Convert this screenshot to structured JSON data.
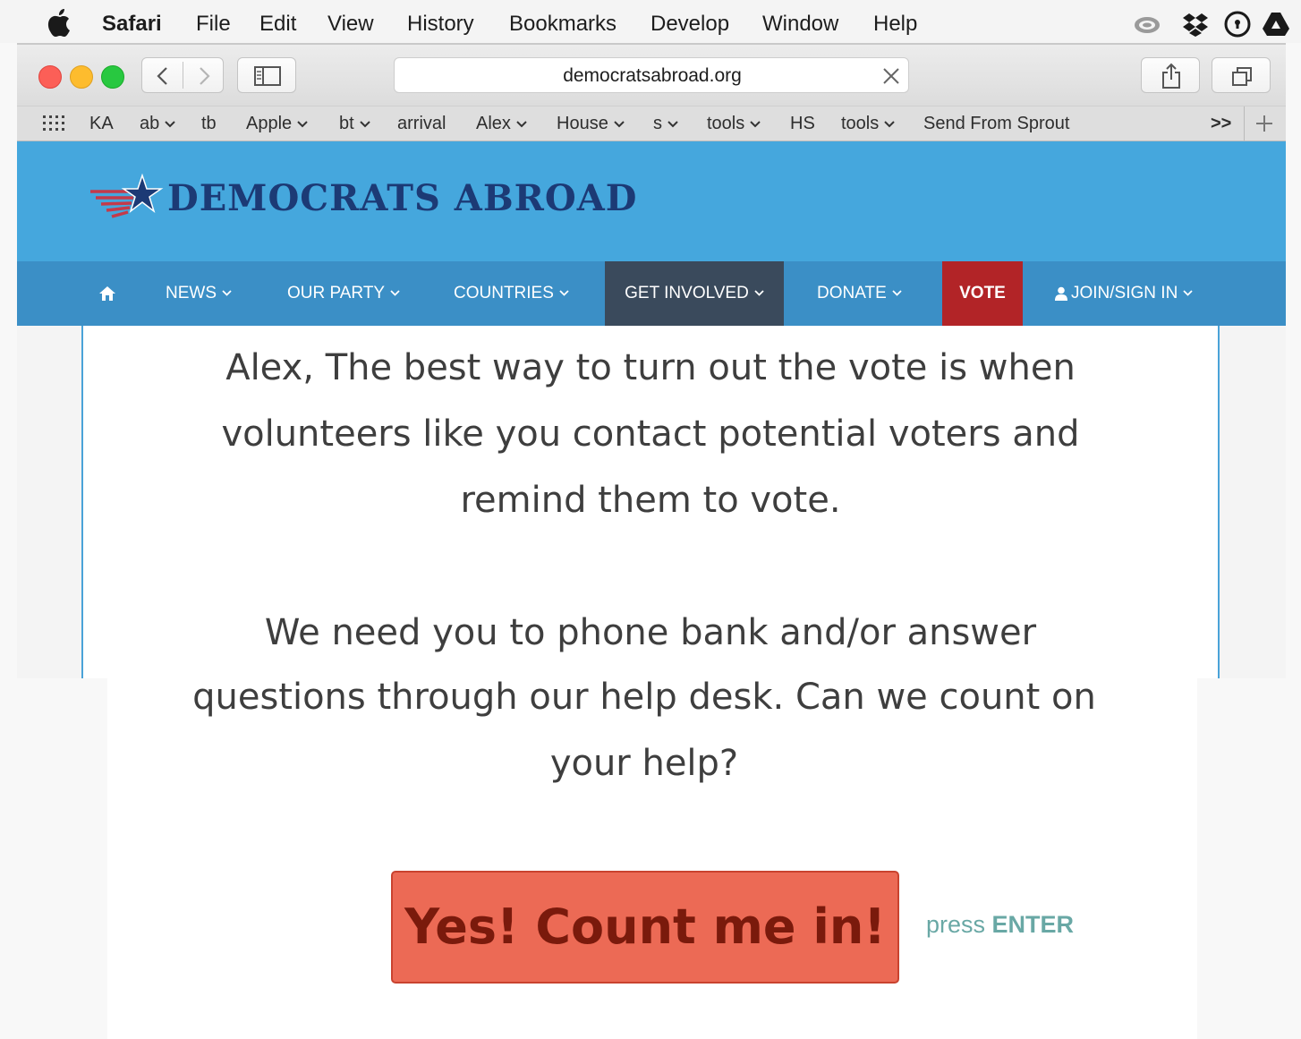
{
  "menubar": {
    "app_name": "Safari",
    "items": [
      "File",
      "Edit",
      "View",
      "History",
      "Bookmarks",
      "Develop",
      "Window",
      "Help"
    ],
    "status_icons": [
      "creative-cloud-icon",
      "dropbox-icon",
      "password-manager-icon",
      "google-drive-icon"
    ]
  },
  "toolbar": {
    "url": "democratsabroad.org",
    "back_icon": "chevron-left-icon",
    "forward_icon": "chevron-right-icon",
    "sidebar_icon": "sidebar-icon",
    "share_icon": "share-icon",
    "tabs_icon": "tabs-overview-icon"
  },
  "bookmarks": {
    "items": [
      {
        "label": "KA",
        "has_menu": false
      },
      {
        "label": "ab",
        "has_menu": true
      },
      {
        "label": "tb",
        "has_menu": false
      },
      {
        "label": "Apple",
        "has_menu": true
      },
      {
        "label": "bt",
        "has_menu": true
      },
      {
        "label": "arrival",
        "has_menu": false
      },
      {
        "label": "Alex",
        "has_menu": true
      },
      {
        "label": "House",
        "has_menu": true
      },
      {
        "label": "s",
        "has_menu": true
      },
      {
        "label": "tools",
        "has_menu": true
      },
      {
        "label": "HS",
        "has_menu": false
      },
      {
        "label": "tools",
        "has_menu": true
      },
      {
        "label": "Send From Sprout",
        "has_menu": false
      }
    ],
    "overflow": ">>"
  },
  "site": {
    "logo_text": "DEMOCRATS ABROAD",
    "nav": [
      {
        "label": "NEWS"
      },
      {
        "label": "OUR PARTY"
      },
      {
        "label": "COUNTRIES"
      },
      {
        "label": "GET INVOLVED"
      },
      {
        "label": "DONATE"
      },
      {
        "label": "VOTE"
      },
      {
        "label": "JOIN/SIGN IN"
      }
    ],
    "colors": {
      "header": "#45a7dd",
      "nav": "#3b8fc6",
      "nav_active": "#3a4a5c",
      "vote": "#b22427",
      "logo": "#1c3a75"
    }
  },
  "content": {
    "para1_lines": [
      "Alex, The best way to turn out the vote is when",
      "volunteers like you contact potential voters and",
      "remind them to vote."
    ],
    "para2_lines": [
      "We need you to phone bank and/or answer",
      "questions through our help desk.  Can we count on",
      "your help?"
    ],
    "cta_label": "Yes! Count me in!",
    "press_label": "press",
    "press_key": "ENTER",
    "cta_color": "#ec6a55"
  }
}
